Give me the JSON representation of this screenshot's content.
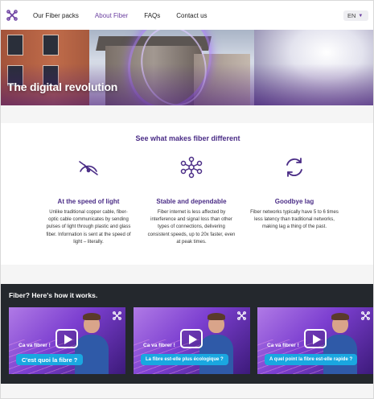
{
  "header": {
    "nav": [
      {
        "label": "Our Fiber packs",
        "active": false
      },
      {
        "label": "About Fiber",
        "active": true
      },
      {
        "label": "FAQs",
        "active": false
      },
      {
        "label": "Contact us",
        "active": false
      }
    ],
    "language": "EN",
    "logo_icon": "fiber-node-icon"
  },
  "hero": {
    "title": "The digital revolution"
  },
  "features": {
    "heading": "See what makes fiber different",
    "items": [
      {
        "icon": "speedometer-icon",
        "title": "At the speed of light",
        "text": "Unlike traditional copper cable, fiber-optic cable communicates by sending pulses of light through plastic and glass fiber. Information is sent at the speed of light – literally."
      },
      {
        "icon": "network-nodes-icon",
        "title": "Stable and dependable",
        "text": "Fiber internet is less affected by interference and signal loss than other types of connections, delivering consistent speeds, up to 20x faster, even at peak times."
      },
      {
        "icon": "refresh-arrows-icon",
        "title": "Goodbye lag",
        "text": "Fiber networks typically have 5 to 6 times less latency than traditional networks, making lag a thing of the past."
      }
    ]
  },
  "videos": {
    "heading": "Fiber? Here's how it works.",
    "items": [
      {
        "intro": "Ca va fibrer !",
        "caption": "C'est quoi la fibre ?"
      },
      {
        "intro": "Ca va fibrer !",
        "caption": "La fibre est-elle plus écologique ?"
      },
      {
        "intro": "Ca va fibrer !",
        "caption": "A quel point la fibre est-elle rapide ?"
      }
    ]
  },
  "colors": {
    "brand_purple": "#4a2c86",
    "nav_active": "#6b3fa0",
    "video_section_bg": "#24282d",
    "caption_pill": "#1aa7e0"
  }
}
